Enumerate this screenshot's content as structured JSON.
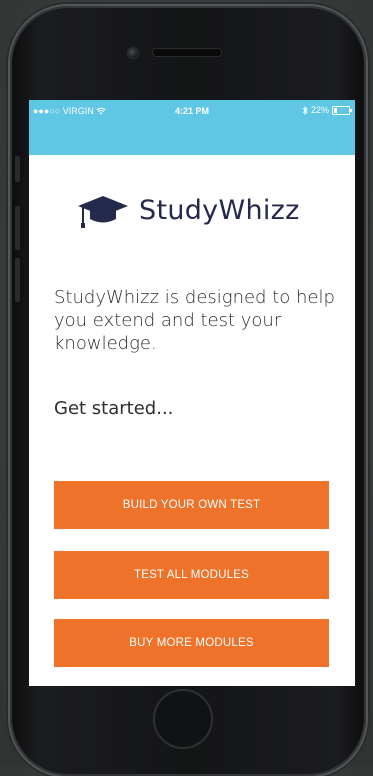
{
  "status_bar": {
    "signal_dots": "●●●○○",
    "carrier": "VIRGIN",
    "wifi_icon": "wifi-icon",
    "time": "4:21 PM",
    "bluetooth_icon": "bluetooth-icon",
    "battery": "22%",
    "color": "#5fc6e4"
  },
  "app": {
    "logo_icon": "graduation-cap-icon",
    "name": "StudyWhizz",
    "intro": "StudyWhizz is designed to help you extend and test your knowledge.",
    "get_started": "Get started..."
  },
  "buttons": {
    "build_test": "BUILD YOUR OWN TEST",
    "test_all": "TEST ALL MODULES",
    "buy_more": "BUY MORE MODULES",
    "color": "#ef722a"
  }
}
